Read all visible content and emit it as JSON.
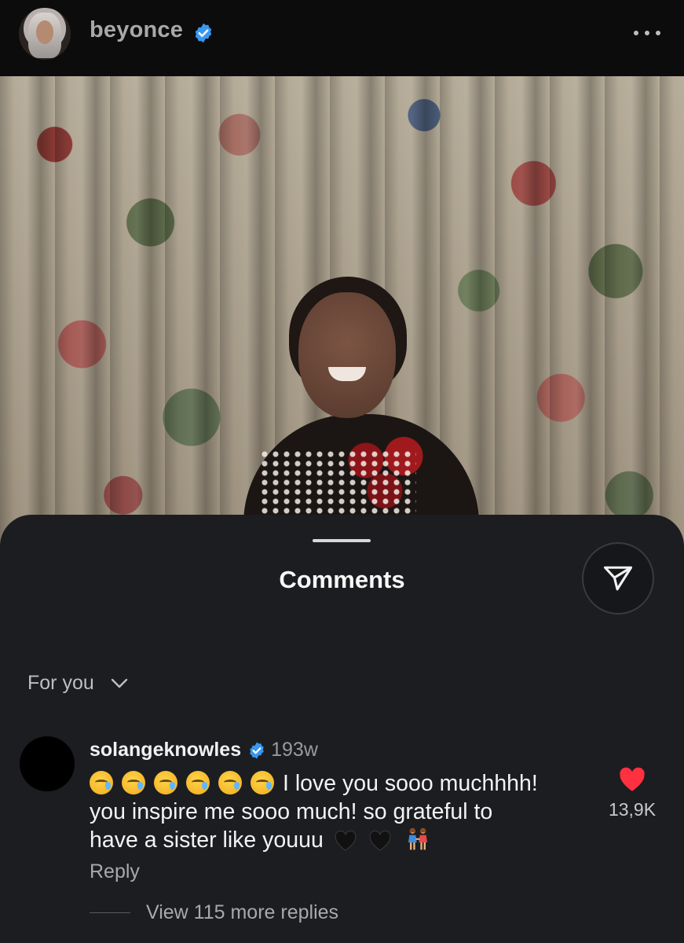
{
  "post": {
    "username": "beyonce",
    "more_label": ""
  },
  "sheet": {
    "title": "Comments",
    "filter_label": "For you"
  },
  "comment": {
    "username": "solangeknowles",
    "time": "193w",
    "text_line1": "I love you sooo muchhhh!",
    "text_line2": "you inspire me sooo much! so grateful to",
    "text_line3": "have a sister like youuu",
    "like_count": "13,9K",
    "reply_label": "Reply",
    "view_replies": "View 115 more replies"
  },
  "colors": {
    "sheet_bg": "#1c1d21",
    "verified_blue": "#3897f0",
    "like_red": "#ff3040"
  },
  "icons": {
    "verified": "verified-badge-icon",
    "more": "more-options-icon",
    "share": "paper-plane-icon",
    "chevron": "chevron-down-icon",
    "like": "heart-filled-icon"
  }
}
